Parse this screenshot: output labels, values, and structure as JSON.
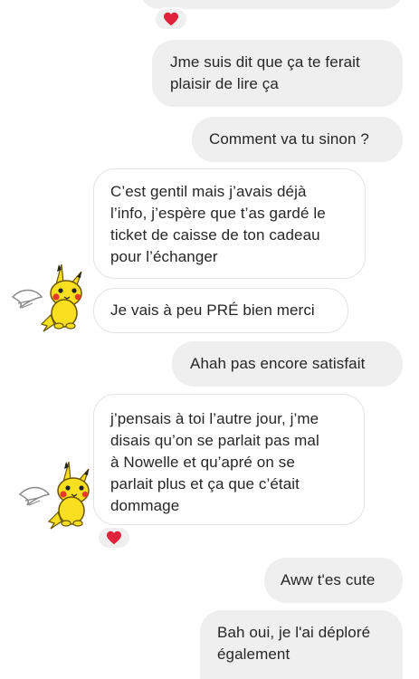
{
  "conversation": {
    "top_reaction": "heart",
    "messages": [
      {
        "direction": "sent",
        "lines": [
          "Jme suis dit que ça te ferait",
          "plaisir de lire ça"
        ]
      },
      {
        "direction": "sent",
        "lines": [
          "Comment va tu sinon ?"
        ]
      },
      {
        "direction": "received",
        "lines": [
          "C’est gentil mais j’avais déjà",
          "l’info, j’espère que t’as gardé le",
          "ticket de caisse de ton cadeau",
          "pour l’échanger"
        ]
      },
      {
        "direction": "received",
        "lines": [
          "Je vais à peu PRÉ bien merci"
        ]
      },
      {
        "direction": "sent",
        "lines": [
          "Ahah pas encore satisfait"
        ]
      },
      {
        "direction": "received",
        "lines": [
          "j’pensais à toi l’autre jour, j’me",
          "disais qu’on se parlait pas mal",
          "à Nowelle et qu’apré on se",
          "parlait plus et ça que c’était",
          "dommage"
        ],
        "reaction": "heart"
      },
      {
        "direction": "sent",
        "lines": [
          "Aww t'es cute"
        ]
      },
      {
        "direction": "sent",
        "lines": [
          "Bah oui, je l'ai déploré",
          "également"
        ]
      }
    ]
  },
  "colors": {
    "sent_bubble": "#efefef",
    "received_border": "#e3e3e3",
    "heart": "#e0223a",
    "pikachu_yellow": "#f8e020",
    "wing_white": "#ffffff"
  },
  "icons": {
    "reaction_icon": "heart-icon",
    "avatar_icon": "winged-pikachu-avatar"
  }
}
